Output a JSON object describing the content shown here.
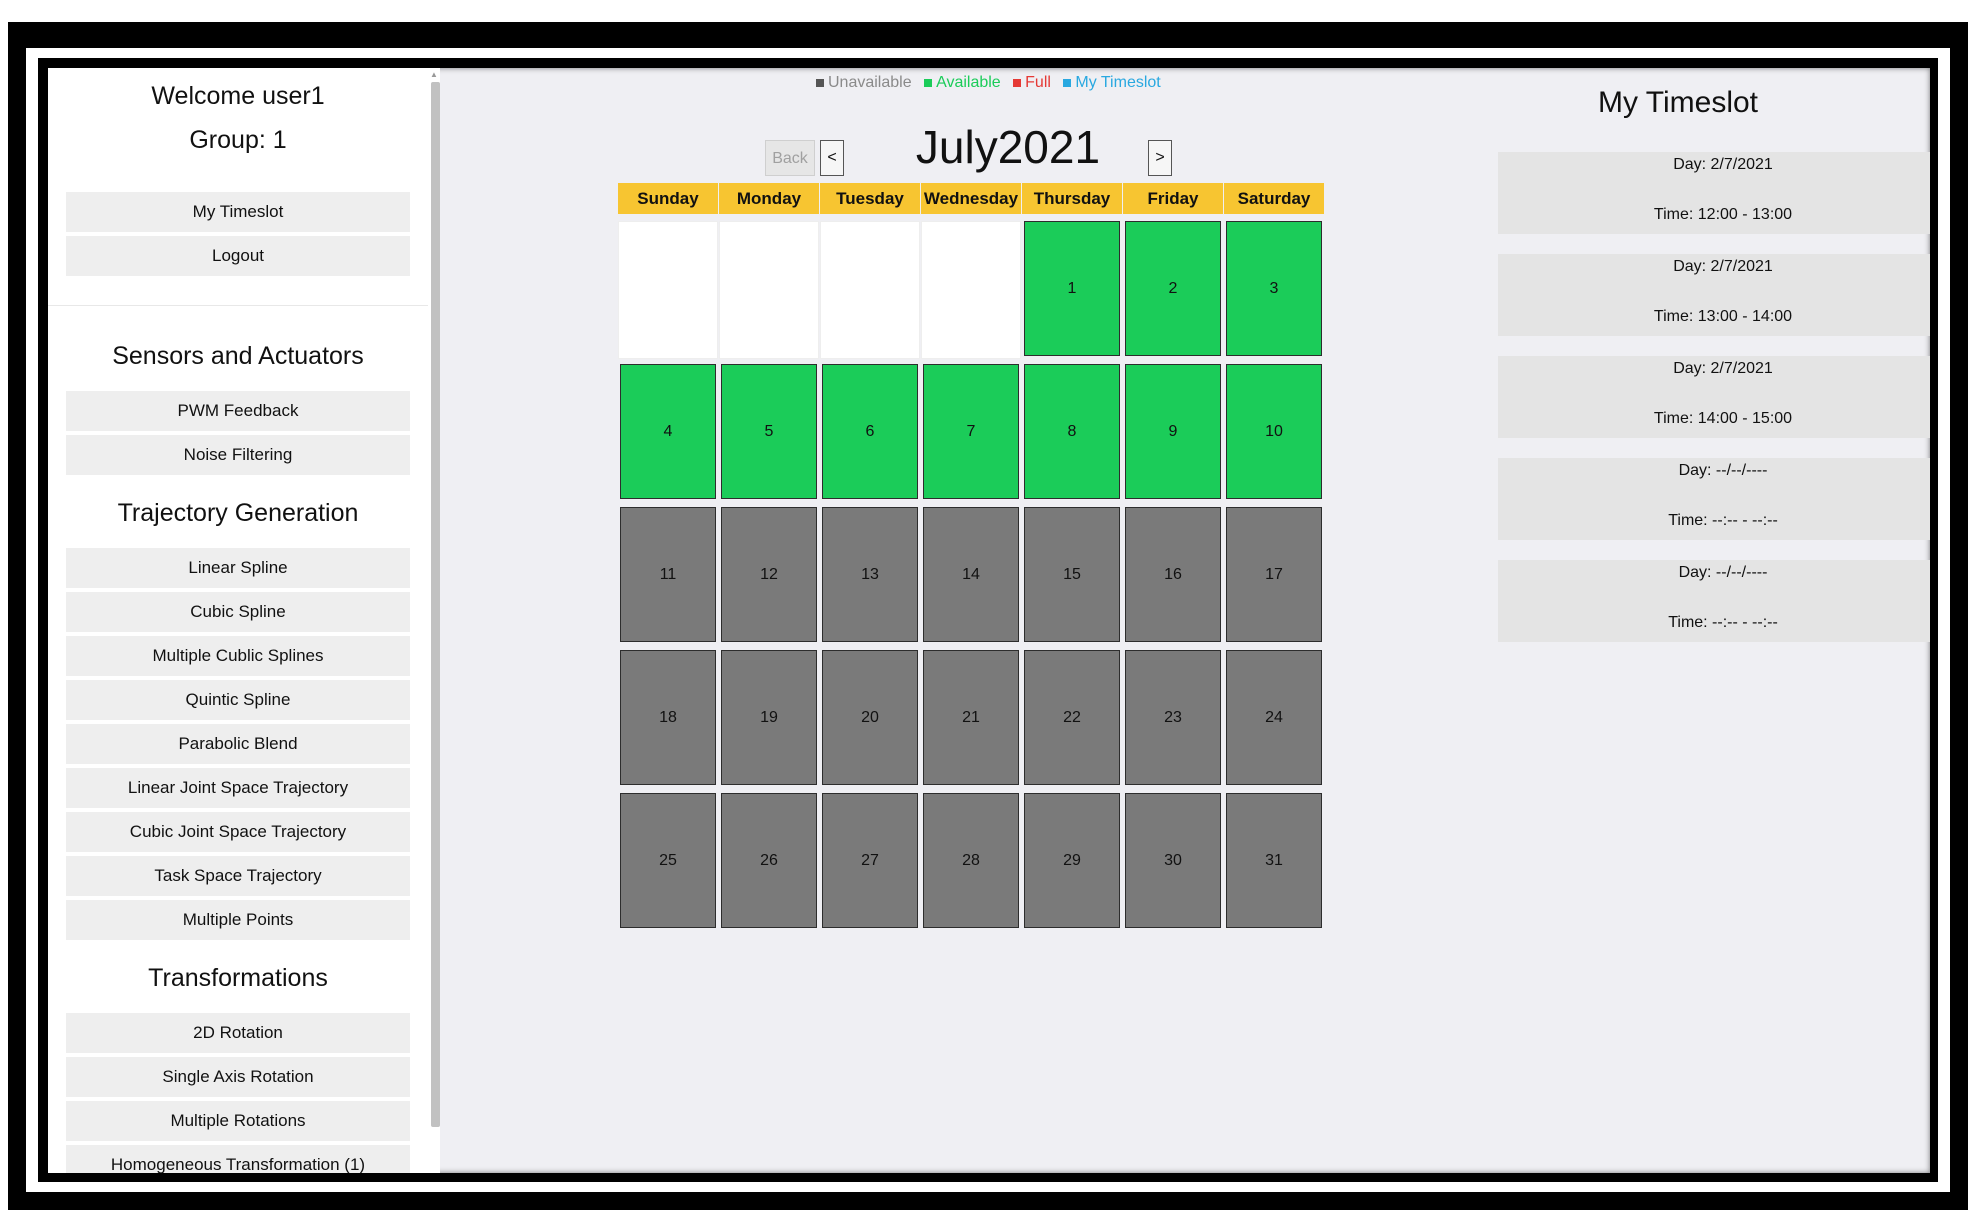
{
  "sidebar": {
    "welcome": "Welcome user1",
    "group": "Group: 1",
    "top_items": [
      "My Timeslot",
      "Logout"
    ],
    "sections": [
      {
        "title": "Sensors and Actuators",
        "items": [
          "PWM Feedback",
          "Noise Filtering"
        ]
      },
      {
        "title": "Trajectory Generation",
        "items": [
          "Linear Spline",
          "Cubic Spline",
          "Multiple Cublic Splines",
          "Quintic Spline",
          "Parabolic Blend",
          "Linear Joint Space Trajectory",
          "Cubic Joint Space Trajectory",
          "Task Space Trajectory",
          "Multiple Points"
        ]
      },
      {
        "title": "Transformations",
        "items": [
          "2D Rotation",
          "Single Axis Rotation",
          "Multiple Rotations",
          "Homogeneous Transformation (1)"
        ]
      }
    ]
  },
  "legend": [
    {
      "label": "Unavailable",
      "color": "#8a8a8a"
    },
    {
      "label": "Available",
      "color": "#1bcc59"
    },
    {
      "label": "Full",
      "color": "#e53935"
    },
    {
      "label": "My Timeslot",
      "color": "#29a8e0"
    }
  ],
  "calendar": {
    "back_label": "Back",
    "prev_label": "<",
    "next_label": ">",
    "month_label": "July2021",
    "weekdays": [
      "Sunday",
      "Monday",
      "Tuesday",
      "Wednesday",
      "Thursday",
      "Friday",
      "Saturday"
    ],
    "first_weekday_index": 4,
    "days": [
      {
        "day": "1",
        "status": "available"
      },
      {
        "day": "2",
        "status": "available"
      },
      {
        "day": "3",
        "status": "available"
      },
      {
        "day": "4",
        "status": "available"
      },
      {
        "day": "5",
        "status": "available"
      },
      {
        "day": "6",
        "status": "available"
      },
      {
        "day": "7",
        "status": "available"
      },
      {
        "day": "8",
        "status": "available"
      },
      {
        "day": "9",
        "status": "available"
      },
      {
        "day": "10",
        "status": "available"
      },
      {
        "day": "11",
        "status": "unavailable"
      },
      {
        "day": "12",
        "status": "unavailable"
      },
      {
        "day": "13",
        "status": "unavailable"
      },
      {
        "day": "14",
        "status": "unavailable"
      },
      {
        "day": "15",
        "status": "unavailable"
      },
      {
        "day": "16",
        "status": "unavailable"
      },
      {
        "day": "17",
        "status": "unavailable"
      },
      {
        "day": "18",
        "status": "unavailable"
      },
      {
        "day": "19",
        "status": "unavailable"
      },
      {
        "day": "20",
        "status": "unavailable"
      },
      {
        "day": "21",
        "status": "unavailable"
      },
      {
        "day": "22",
        "status": "unavailable"
      },
      {
        "day": "23",
        "status": "unavailable"
      },
      {
        "day": "24",
        "status": "unavailable"
      },
      {
        "day": "25",
        "status": "unavailable"
      },
      {
        "day": "26",
        "status": "unavailable"
      },
      {
        "day": "27",
        "status": "unavailable"
      },
      {
        "day": "28",
        "status": "unavailable"
      },
      {
        "day": "29",
        "status": "unavailable"
      },
      {
        "day": "30",
        "status": "unavailable"
      },
      {
        "day": "31",
        "status": "unavailable"
      }
    ]
  },
  "timeslot_panel": {
    "title": "My Timeslot",
    "slots": [
      {
        "day": "Day: 2/7/2021",
        "time": "Time: 12:00 - 13:00"
      },
      {
        "day": "Day: 2/7/2021",
        "time": "Time: 13:00 - 14:00"
      },
      {
        "day": "Day: 2/7/2021",
        "time": "Time: 14:00 - 15:00"
      },
      {
        "day": "Day: --/--/----",
        "time": "Time: --:-- - --:--"
      },
      {
        "day": "Day: --/--/----",
        "time": "Time: --:-- - --:--"
      }
    ]
  }
}
